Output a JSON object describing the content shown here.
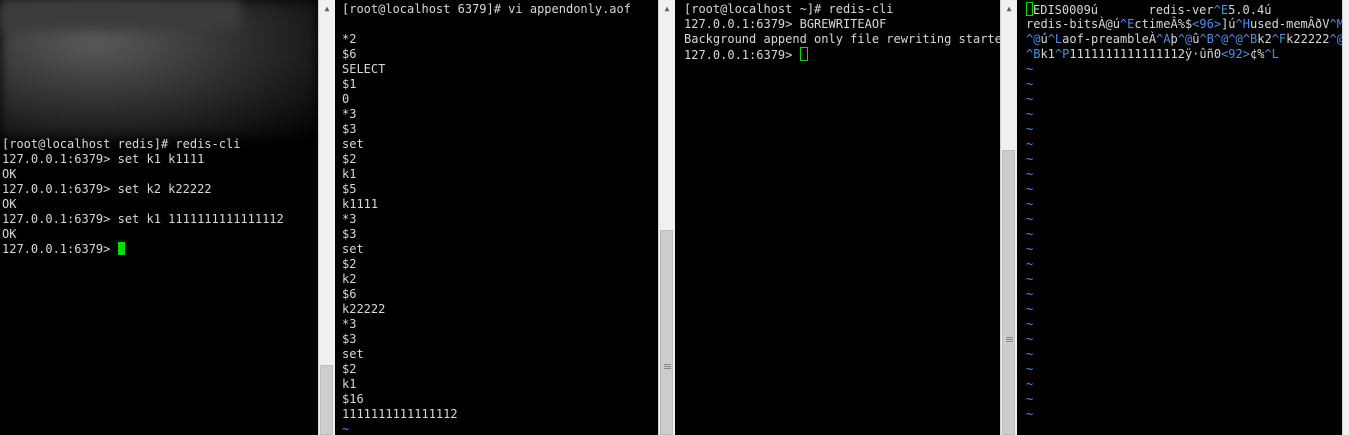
{
  "panes": [
    {
      "lines": [
        {
          "t": "[root@localhost redis]# redis-cli"
        },
        {
          "t": "127.0.0.1:6379> set k1 k1111"
        },
        {
          "t": "OK"
        },
        {
          "t": "127.0.0.1:6379> set k2 k22222"
        },
        {
          "t": "OK"
        },
        {
          "t": "127.0.0.1:6379> set k1 1111111111111112"
        },
        {
          "t": "OK"
        },
        {
          "t": "127.0.0.1:6379> "
        }
      ]
    },
    {
      "lines": [
        {
          "t": "[root@localhost 6379]# vi appendonly.aof"
        },
        {
          "t": ""
        },
        {
          "t": "*2"
        },
        {
          "t": "$6"
        },
        {
          "t": "SELECT"
        },
        {
          "t": "$1"
        },
        {
          "t": "0"
        },
        {
          "t": "*3"
        },
        {
          "t": "$3"
        },
        {
          "t": "set"
        },
        {
          "t": "$2"
        },
        {
          "t": "k1"
        },
        {
          "t": "$5"
        },
        {
          "t": "k1111"
        },
        {
          "t": "*3"
        },
        {
          "t": "$3"
        },
        {
          "t": "set"
        },
        {
          "t": "$2"
        },
        {
          "t": "k2"
        },
        {
          "t": "$6"
        },
        {
          "t": "k22222"
        },
        {
          "t": "*3"
        },
        {
          "t": "$3"
        },
        {
          "t": "set"
        },
        {
          "t": "$2"
        },
        {
          "t": "k1"
        },
        {
          "t": "$16"
        },
        {
          "t": "1111111111111112"
        },
        {
          "t": "~"
        }
      ]
    },
    {
      "lines": [
        {
          "t": "[root@localhost ~]# redis-cli"
        },
        {
          "t": "127.0.0.1:6379> BGREWRITEAOF"
        },
        {
          "t": "Background append only file rewriting starte"
        },
        {
          "t": "127.0.0.1:6379> "
        }
      ]
    },
    {
      "line1": {
        "a": "EDIS0009ú",
        "b": "       redis-ver",
        "c": "^E",
        "d": "5.0.4ú"
      },
      "line2": {
        "a": "redis-bitsÀ@ú",
        "b": "^E",
        "c": "ctimeÂ%$",
        "d": "<96>",
        "e": "]ú",
        "f": "^H",
        "g": "used-memÂðV",
        "h": "^M"
      },
      "line3": {
        "a": "^@",
        "b": "ú",
        "c": "^L",
        "d": "aof-preambleÀ",
        "e": "^A",
        "f": "þ",
        "g": "^@",
        "h": "û",
        "i": "^B^@^@",
        "j": "^B",
        "k": "k2",
        "l": "^F",
        "m": "k22222",
        "n": "^@"
      },
      "line4": {
        "a": "^B",
        "b": "k1",
        "c": "^P",
        "d": "1111111111111112ÿ·ûñ0",
        "e": "<92>",
        "f": "¢%",
        "g": "^L"
      },
      "tilde": "~"
    }
  ]
}
